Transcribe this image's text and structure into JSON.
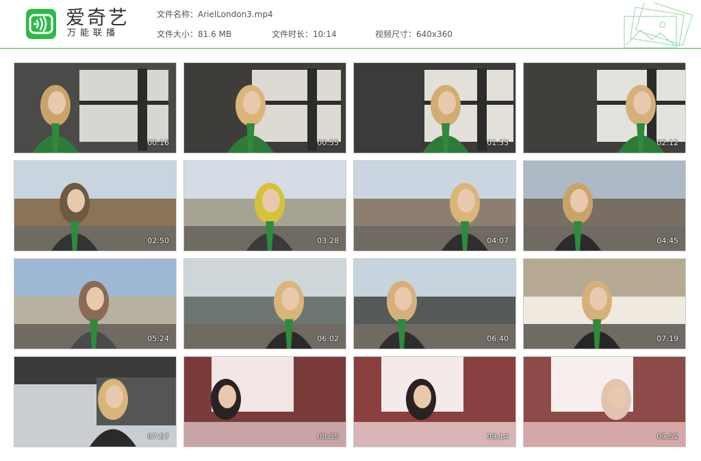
{
  "brand": {
    "title": "爱奇艺",
    "subtitle": "万能联播",
    "logo_icon": "tv-broadcast-icon",
    "color": "#2fb84a"
  },
  "file_info": {
    "name": "文件名称：ArielLondon3.mp4",
    "size": "文件大小：81.6 MB",
    "duration": "文件时长：10:14",
    "dimensions": "视频尺寸：640x360"
  },
  "thumbnails": [
    {
      "time": "00:16",
      "palette": [
        "#4a4a48",
        "#d8d6d0",
        "#c9a46a",
        "#2f7a3a"
      ]
    },
    {
      "time": "00:55",
      "palette": [
        "#3e3d3a",
        "#dcdad2",
        "#d9b57a",
        "#2f7a3a"
      ]
    },
    {
      "time": "01:33",
      "palette": [
        "#3b3b39",
        "#e2e0d8",
        "#d1ad72",
        "#2f7a3a"
      ]
    },
    {
      "time": "02:12",
      "palette": [
        "#403f3c",
        "#e4e2dc",
        "#d6b07a",
        "#2f7a3a"
      ]
    },
    {
      "time": "02:50",
      "palette": [
        "#c8d4e0",
        "#8a7357",
        "#6c5a42",
        "#333333"
      ]
    },
    {
      "time": "03:28",
      "palette": [
        "#d5dce5",
        "#a7a394",
        "#d6c23a",
        "#3a3a3a"
      ]
    },
    {
      "time": "04:07",
      "palette": [
        "#cbd5e2",
        "#8c7e70",
        "#d9b57a",
        "#2f2f2f"
      ]
    },
    {
      "time": "04:45",
      "palette": [
        "#aeb9c6",
        "#786e63",
        "#c9a46a",
        "#2b2b2b"
      ]
    },
    {
      "time": "05:24",
      "palette": [
        "#9fb8d4",
        "#b8b0a0",
        "#8a6a55",
        "#4a4a4a"
      ]
    },
    {
      "time": "06:02",
      "palette": [
        "#cfd6da",
        "#6d7670",
        "#d9b57a",
        "#2a2a2a"
      ]
    },
    {
      "time": "06:40",
      "palette": [
        "#c7d3dd",
        "#555a58",
        "#d6b07a",
        "#2d2d2d"
      ]
    },
    {
      "time": "07:19",
      "palette": [
        "#b6aa94",
        "#efe9df",
        "#d6b07a",
        "#262626"
      ]
    },
    {
      "time": "07:57",
      "palette": [
        "#c8ced2",
        "#3a3a3a",
        "#d9b57a",
        "#2a2a2a"
      ]
    },
    {
      "time": "08:35",
      "palette": [
        "#7a3b3b",
        "#f2e6e6",
        "#2a2222",
        "#c9a4a4"
      ]
    },
    {
      "time": "09:14",
      "palette": [
        "#8a4040",
        "#f4eaea",
        "#2a2222",
        "#d8b4b4"
      ]
    },
    {
      "time": "09:52",
      "palette": [
        "#8c4a48",
        "#f6efee",
        "#e2c3b2",
        "#d6a7a7"
      ]
    }
  ]
}
